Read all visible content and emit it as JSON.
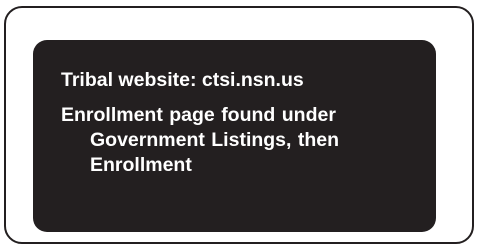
{
  "info_box": {
    "website_line": "Tribal website: ctsi.nsn.us",
    "enrollment_line": "Enrollment page found under Government Listings, then Enrollment"
  },
  "colors": {
    "panel_background": "#231f20",
    "panel_text": "#ffffff",
    "frame_border": "#231f20",
    "page_background": "#ffffff"
  }
}
